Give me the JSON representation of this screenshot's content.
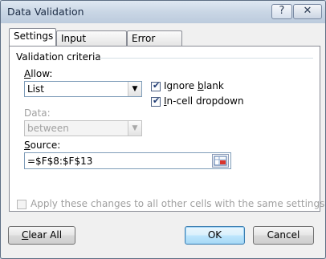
{
  "window": {
    "title": "Data Validation",
    "help_label": "?",
    "close_label": "✕"
  },
  "tabs": [
    {
      "label": "Settings",
      "active": true
    },
    {
      "label": "Input Message",
      "active": false
    },
    {
      "label": "Error Alert",
      "active": false
    }
  ],
  "settings": {
    "group_title": "Validation criteria",
    "allow": {
      "label_accel": "A",
      "label_rest": "llow:",
      "value": "List"
    },
    "data": {
      "label": "Data:",
      "value": "between",
      "enabled": false
    },
    "ignore_blank": {
      "label_pre": "Ignore ",
      "label_accel": "b",
      "label_post": "lank",
      "checked": true
    },
    "in_cell_dropdown": {
      "label_accel": "I",
      "label_rest": "n-cell dropdown",
      "checked": true
    },
    "source": {
      "label_accel": "S",
      "label_rest": "ource:",
      "value": "=$F$8:$F$13"
    },
    "apply_all": {
      "label": "Apply these changes to all other cells with the same settings",
      "checked": false,
      "enabled": false
    }
  },
  "buttons": {
    "clear_all": {
      "accel": "C",
      "rest": "lear All"
    },
    "ok": "OK",
    "cancel": "Cancel"
  },
  "icons": {
    "dropdown": "chevron-down-icon",
    "check": "checkmark-icon",
    "range_picker": "range-select-icon"
  }
}
